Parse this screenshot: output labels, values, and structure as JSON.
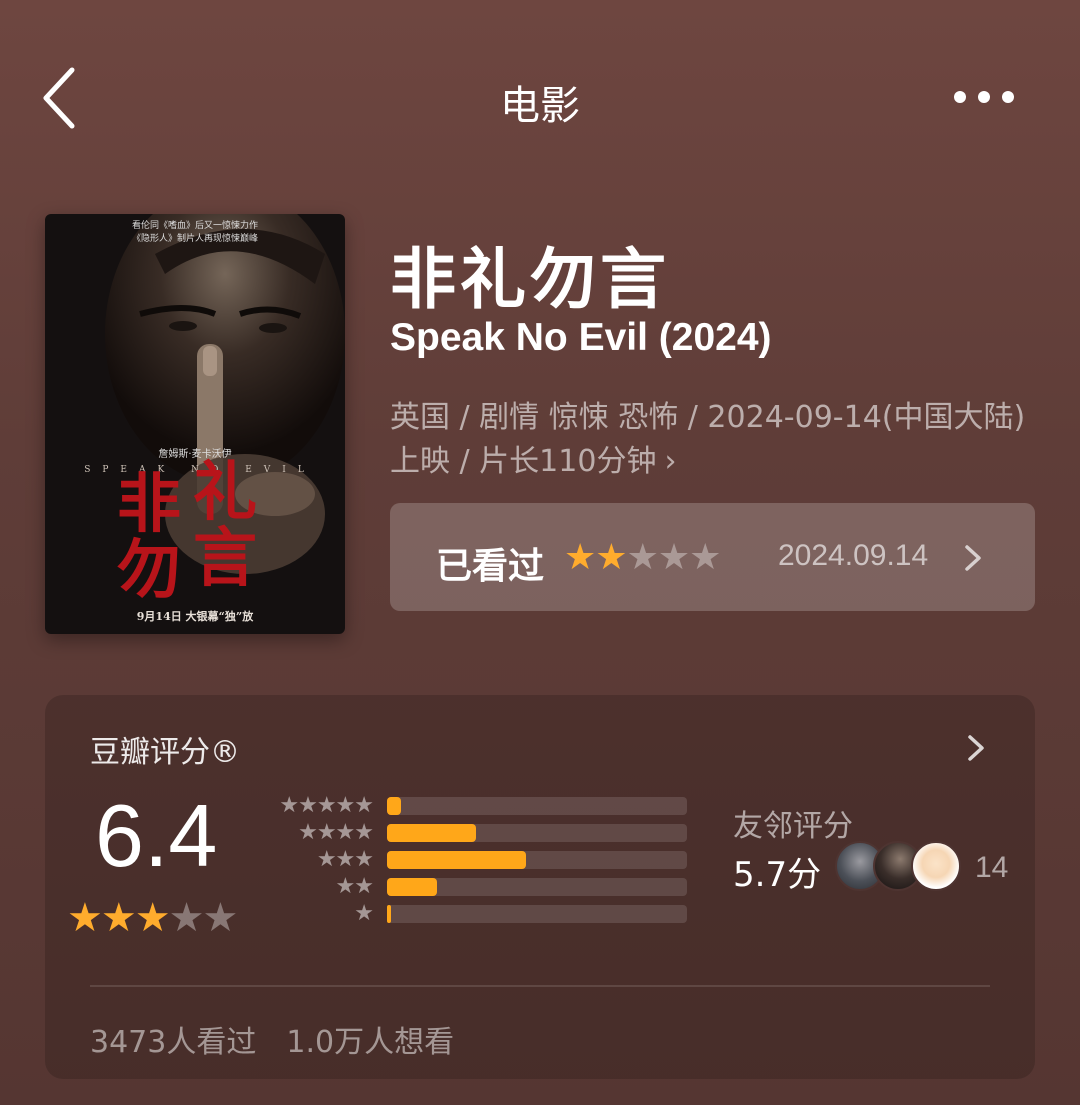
{
  "nav": {
    "title": "电影",
    "back_icon": "chevron-left-icon",
    "more_icon": "more-dots-icon"
  },
  "movie": {
    "title_cn": "非礼勿言",
    "title_en": "Speak No Evil (2024)",
    "meta": "英国 / 剧情 惊悚 恐怖 / 2024-09-14(中国大陆)上映 / 片长110分钟",
    "poster": {
      "tagline_1": "看伦同《嗜血》后又一惊悚力作",
      "tagline_2": "《隐形人》制片人再现惊悚巅峰",
      "actor": "詹姆斯·麦卡沃伊",
      "title_art": "非礼勿言",
      "title_art_en": "SPEAK NO EVIL",
      "release_line": "9月14日 大银幕“独”放"
    }
  },
  "watched": {
    "label": "已看过",
    "user_rating": 2,
    "max_rating": 5,
    "date": "2024.09.14"
  },
  "douban": {
    "header": "豆瓣评分®",
    "score": "6.4",
    "score_stars": 3,
    "distribution": [
      {
        "stars": 5,
        "percent": 4.7
      },
      {
        "stars": 4,
        "percent": 29.5
      },
      {
        "stars": 3,
        "percent": 46.2
      },
      {
        "stars": 2,
        "percent": 16.5
      },
      {
        "stars": 1,
        "percent": 1.2
      }
    ],
    "friends_label": "友邻评分",
    "friends_score": "5.7分",
    "friends_count": "14",
    "watched_count": "3473人看过",
    "want_count": "1.0万人想看"
  },
  "colors": {
    "accent_star": "#ffac2d",
    "bar_fill": "#ffa719",
    "poster_red": "#b8141a"
  }
}
